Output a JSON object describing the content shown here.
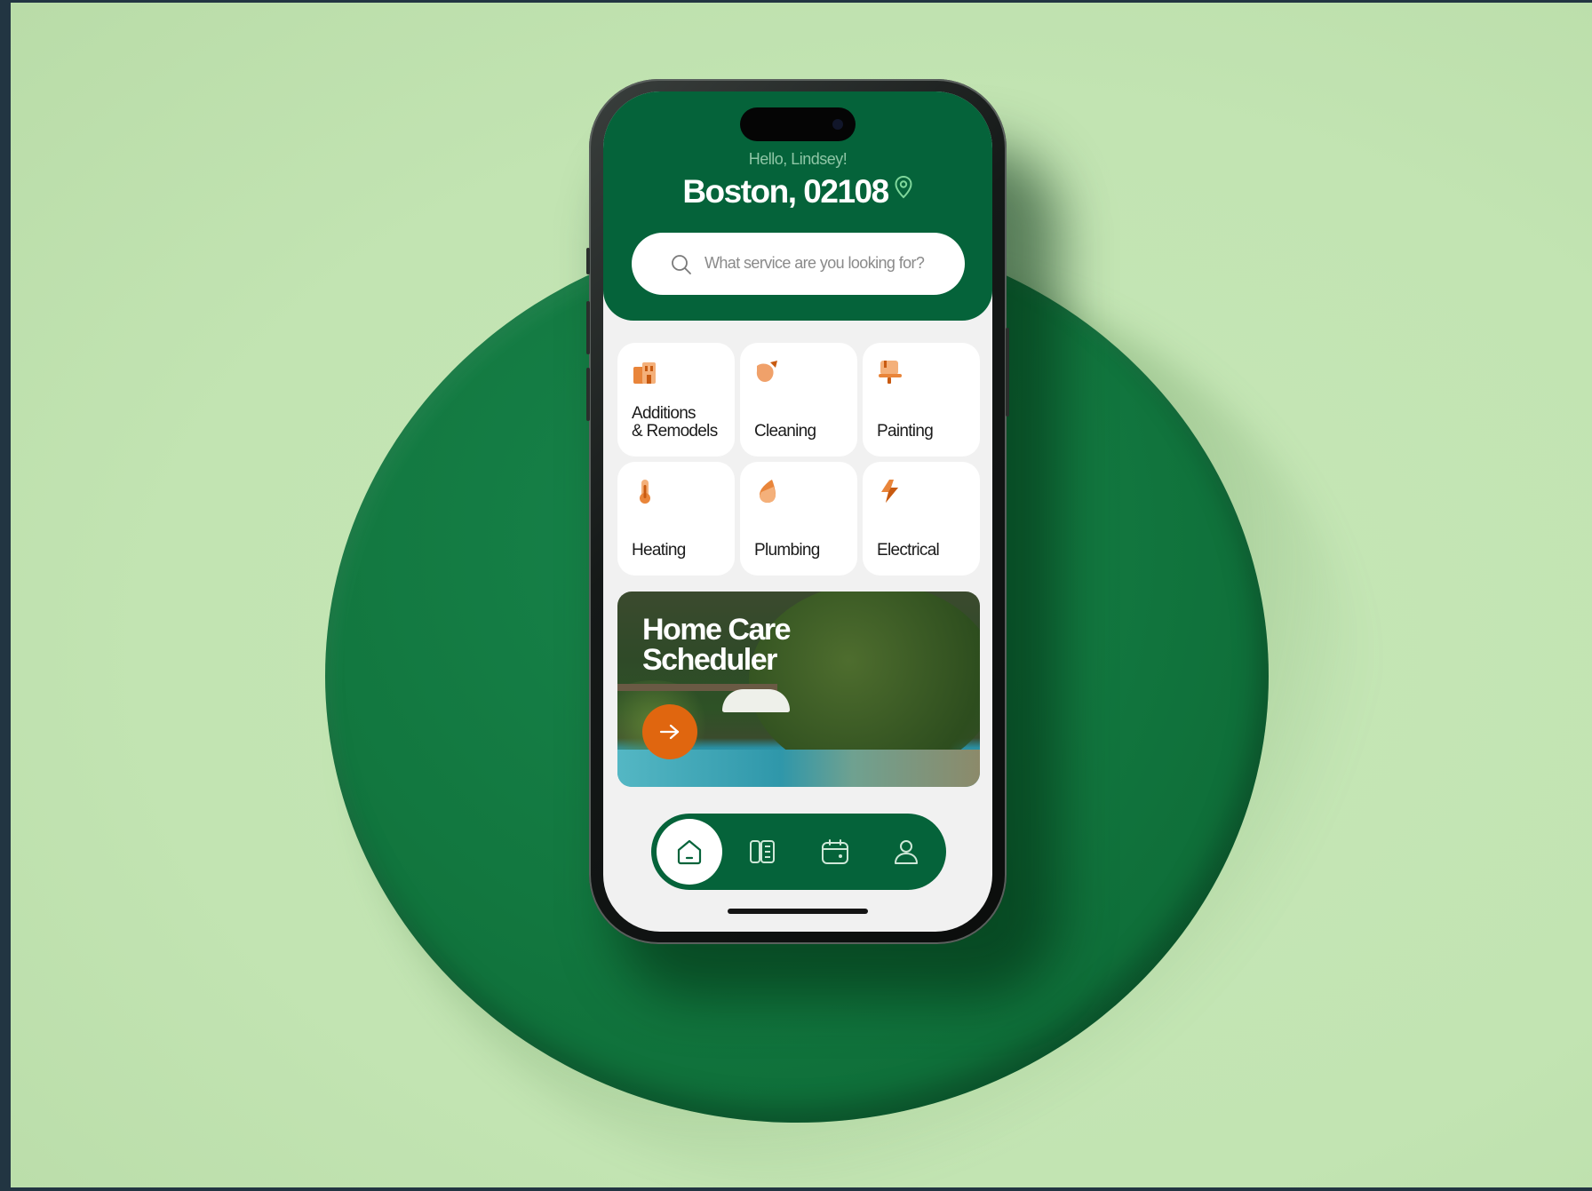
{
  "header": {
    "greeting": "Hello, Lindsey!",
    "location": "Boston, 02108"
  },
  "search": {
    "placeholder": "What service are you looking for?"
  },
  "services": [
    {
      "label": "Additions\n& Remodels",
      "icon": "house-blueprint-icon"
    },
    {
      "label": "Cleaning",
      "icon": "spray-bottle-icon"
    },
    {
      "label": "Painting",
      "icon": "paint-roller-icon"
    },
    {
      "label": "Heating",
      "icon": "thermometer-icon"
    },
    {
      "label": "Plumbing",
      "icon": "water-drop-icon"
    },
    {
      "label": "Electrical",
      "icon": "lightning-icon"
    }
  ],
  "banner": {
    "title": "Home Care\nScheduler"
  },
  "nav": {
    "items": [
      "home-icon",
      "catalog-icon",
      "calendar-icon",
      "profile-icon"
    ],
    "active": "home"
  },
  "colors": {
    "brand_green": "#05633a",
    "accent_orange": "#e0660f",
    "background": "#c2e4b2"
  }
}
